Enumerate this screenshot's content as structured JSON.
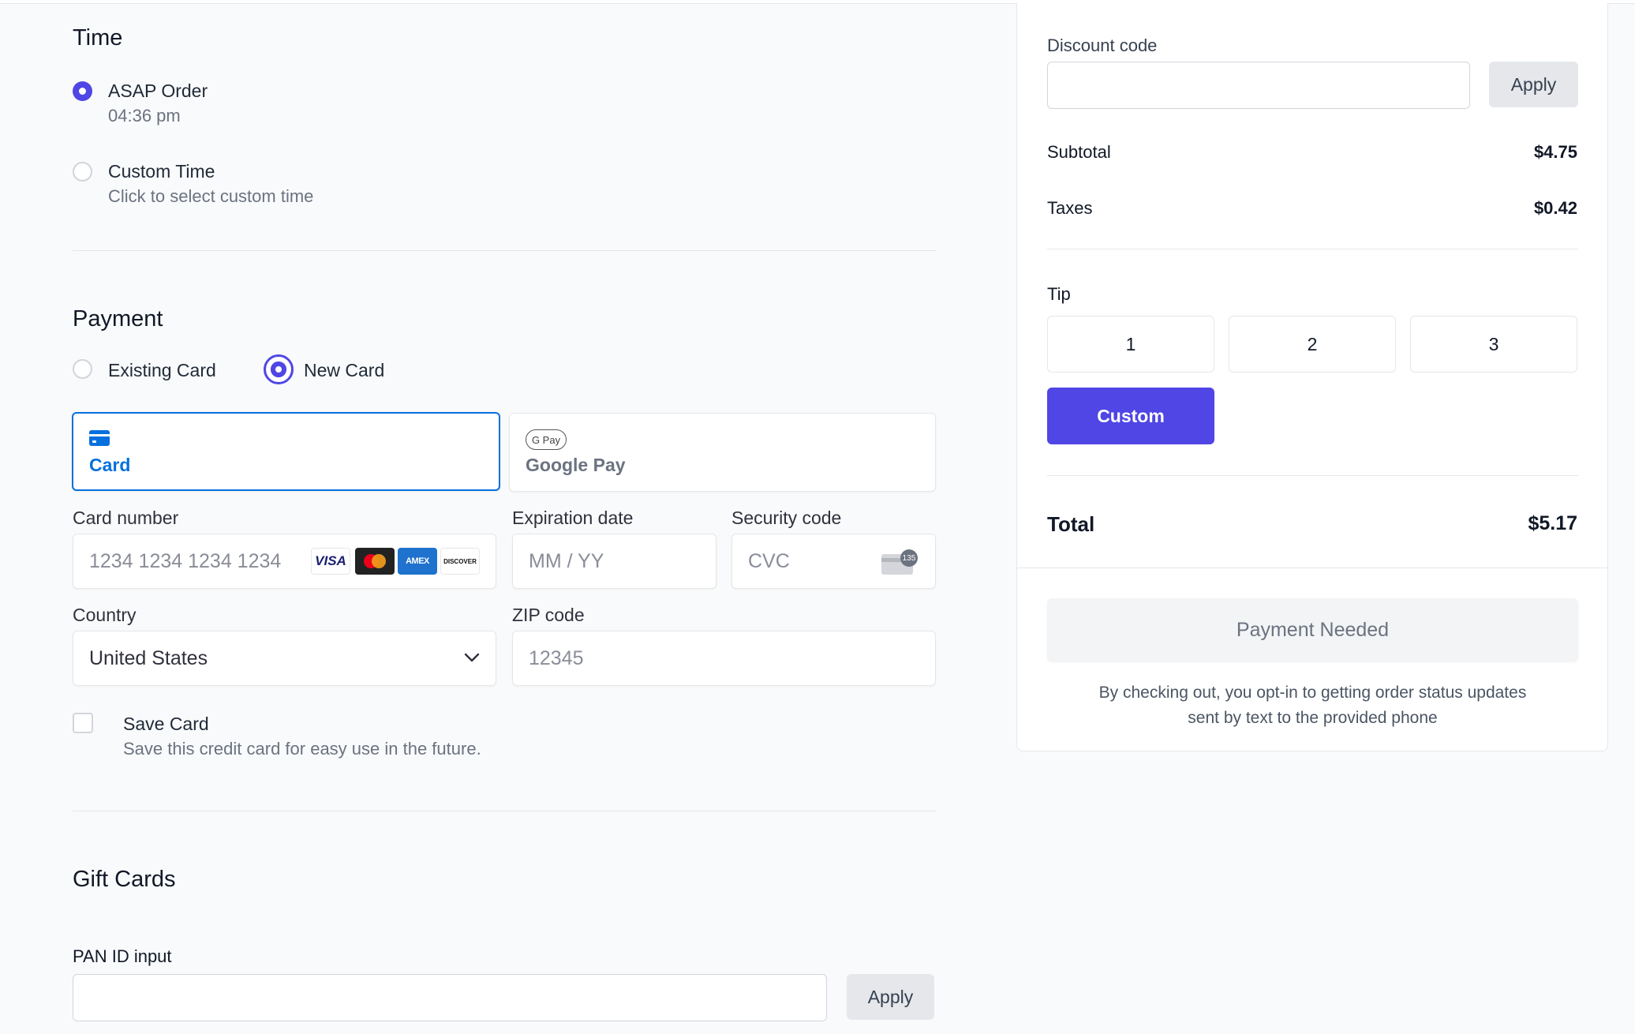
{
  "time": {
    "title": "Time",
    "asap_label": "ASAP Order",
    "asap_time": "04:36 pm",
    "custom_label": "Custom Time",
    "custom_sub": "Click to select custom time"
  },
  "payment": {
    "title": "Payment",
    "existing_label": "Existing Card",
    "new_label": "New Card",
    "tab_card": "Card",
    "tab_gpay": "Google Pay",
    "gpay_badge": "G Pay",
    "card_number_label": "Card number",
    "card_number_placeholder": "1234 1234 1234 1234",
    "brands": [
      "VISA",
      "AMEX",
      "DISCOVER"
    ],
    "exp_label": "Expiration date",
    "exp_placeholder": "MM / YY",
    "cvc_label": "Security code",
    "cvc_placeholder": "CVC",
    "cvc_badge": "135",
    "country_label": "Country",
    "country_value": "United States",
    "zip_label": "ZIP code",
    "zip_placeholder": "12345",
    "save_label": "Save Card",
    "save_sub": "Save this credit card for easy use in the future."
  },
  "gift": {
    "title": "Gift Cards",
    "pan_label": "PAN ID input",
    "apply": "Apply"
  },
  "summary": {
    "discount_label": "Discount code",
    "apply": "Apply",
    "subtotal_label": "Subtotal",
    "subtotal_value": "$4.75",
    "taxes_label": "Taxes",
    "taxes_value": "$0.42",
    "tip_label": "Tip",
    "tips": [
      "1",
      "2",
      "3"
    ],
    "custom_tip": "Custom",
    "total_label": "Total",
    "total_value": "$5.17",
    "pay_button": "Payment Needed",
    "note_line1": "By checking out, you opt-in to getting order status updates",
    "note_line2": "sent by text to the provided phone"
  },
  "colors": {
    "accent": "#4f46e5",
    "stripe_blue": "#0570de"
  }
}
